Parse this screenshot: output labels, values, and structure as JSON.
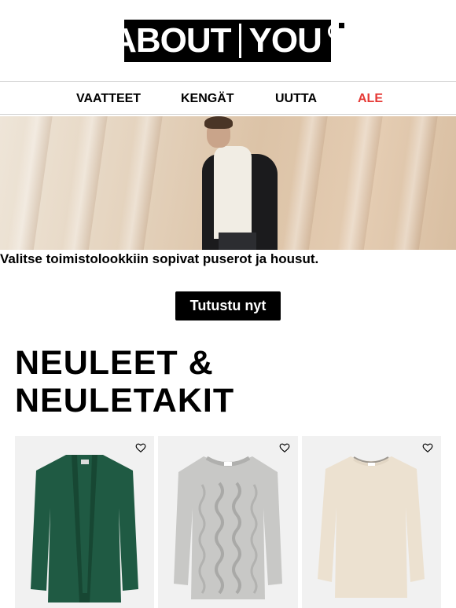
{
  "brand": {
    "logo_left": "ABOUT",
    "logo_right": "YOU"
  },
  "nav": [
    {
      "label": "VAATTEET",
      "color": "#000000"
    },
    {
      "label": "KENGÄT",
      "color": "#000000"
    },
    {
      "label": "UUTTA",
      "color": "#000000"
    },
    {
      "label": "ALE",
      "color": "#e53935"
    }
  ],
  "hero": {
    "caption": "Valitse toimistolookkiin sopivat puserot ja housut.",
    "cta_label": "Tutustu nyt"
  },
  "section": {
    "title": "NEULEET & NEULETAKIT"
  },
  "products": [
    {
      "icon": "heart-icon",
      "color": "#1f5a43"
    },
    {
      "icon": "heart-icon",
      "color": "#c8c8c6"
    },
    {
      "icon": "heart-icon",
      "color": "#ece1d0"
    }
  ],
  "colors": {
    "sale": "#e53935",
    "cta_bg": "#000000",
    "card_bg": "#f1f1f1"
  }
}
